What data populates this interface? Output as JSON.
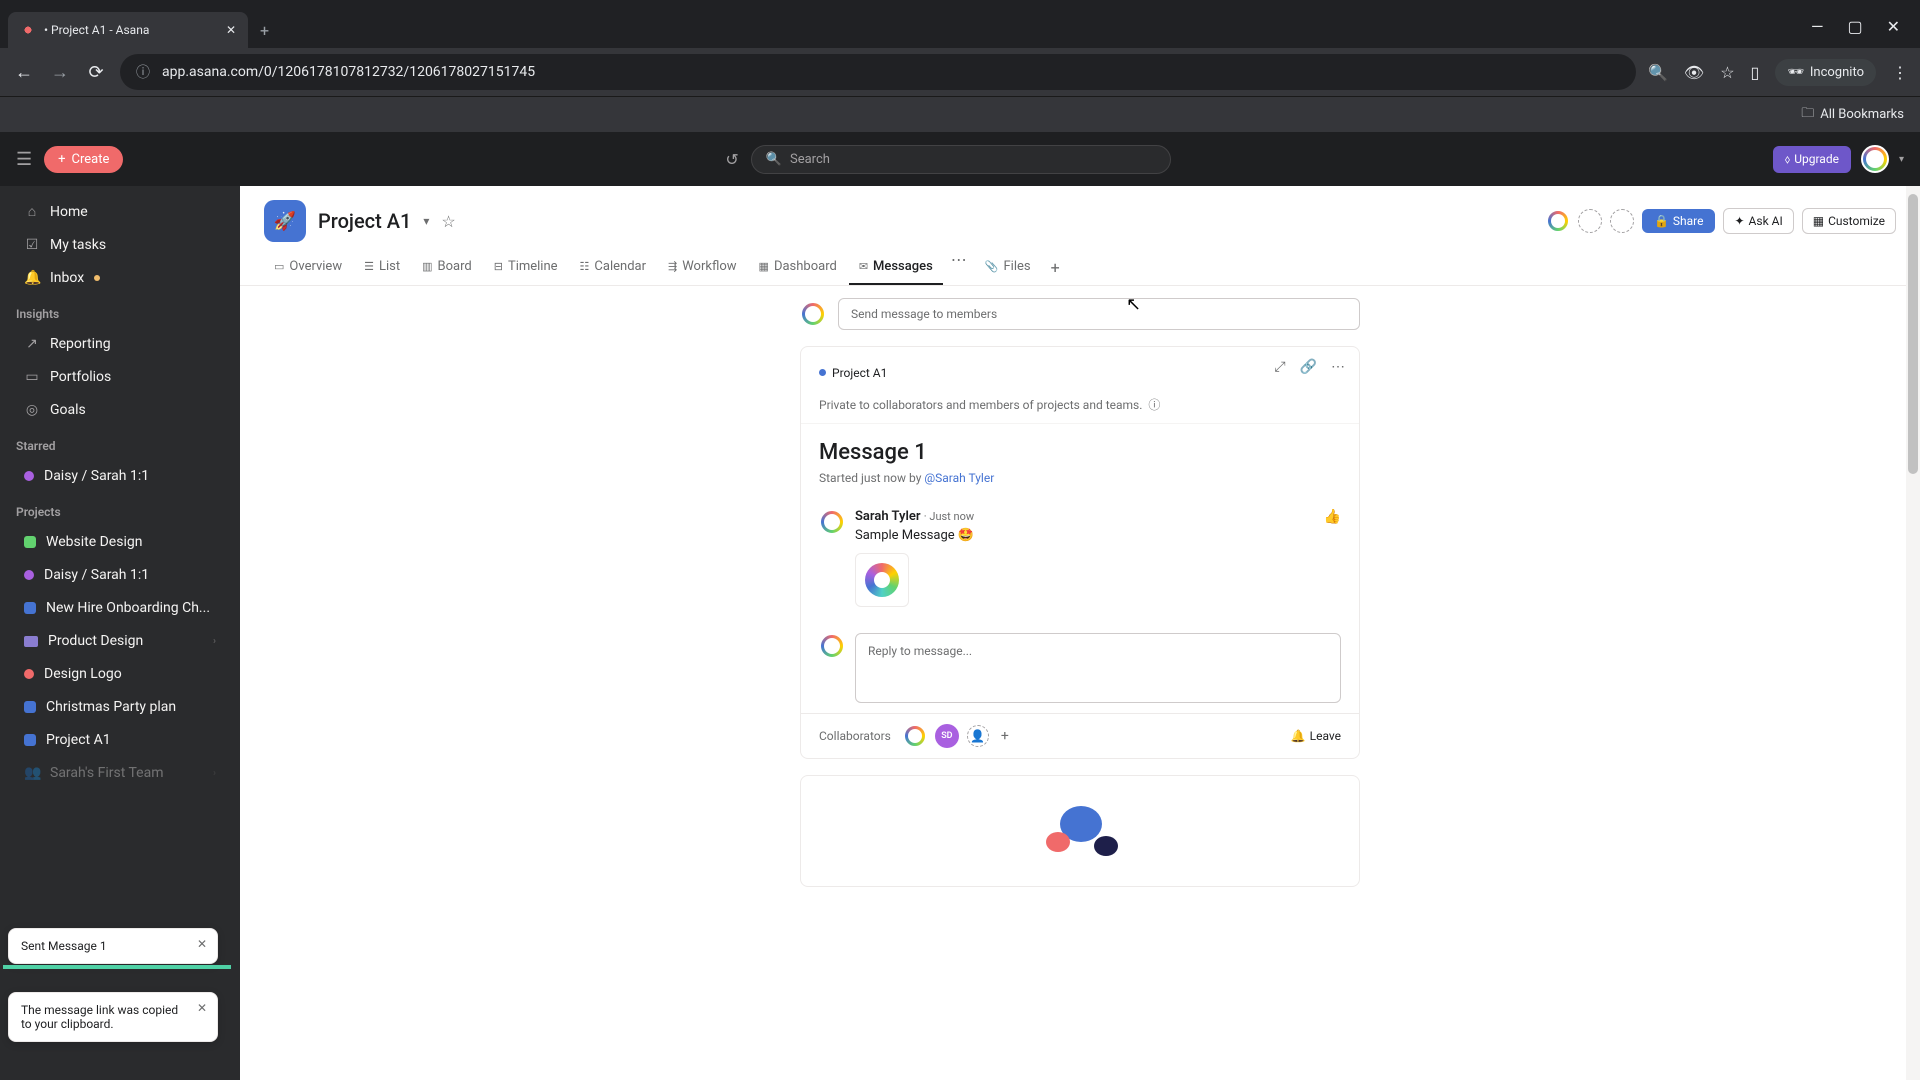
{
  "browser": {
    "tab_title": "• Project A1 - Asana",
    "url": "app.asana.com/0/1206178107812732/1206178027151745",
    "incognito_label": "Incognito",
    "bookmarks_label": "All Bookmarks"
  },
  "header": {
    "create_label": "Create",
    "search_placeholder": "Search",
    "upgrade_label": "Upgrade"
  },
  "sidebar": {
    "nav": [
      {
        "icon": "⌂",
        "label": "Home"
      },
      {
        "icon": "☑",
        "label": "My tasks"
      },
      {
        "icon": "🔔",
        "label": "Inbox",
        "badge": true
      }
    ],
    "insights_heading": "Insights",
    "insights": [
      {
        "icon": "↗",
        "label": "Reporting"
      },
      {
        "icon": "▭",
        "label": "Portfolios"
      },
      {
        "icon": "◎",
        "label": "Goals"
      }
    ],
    "starred_heading": "Starred",
    "starred": [
      {
        "color": "#a960e0",
        "label": "Daisy / Sarah 1:1"
      }
    ],
    "projects_heading": "Projects",
    "projects": [
      {
        "color": "#62d26f",
        "label": "Website Design",
        "type": "square"
      },
      {
        "color": "#a960e0",
        "label": "Daisy / Sarah 1:1",
        "type": "circle"
      },
      {
        "color": "#4573d2",
        "label": "New Hire Onboarding Ch...",
        "type": "square"
      },
      {
        "color": "#8a7dd0",
        "label": "Product Design",
        "type": "folder",
        "expandable": true
      },
      {
        "color": "#f06a6a",
        "label": "Design Logo",
        "type": "circle"
      },
      {
        "color": "#4573d2",
        "label": "Christmas Party plan",
        "type": "square"
      },
      {
        "color": "#4573d2",
        "label": "Project A1",
        "type": "square"
      }
    ],
    "team_label": "Sarah's First Team"
  },
  "project": {
    "title": "Project A1",
    "share_label": "Share",
    "ask_ai_label": "Ask AI",
    "customize_label": "Customize",
    "tabs": [
      {
        "icon": "▭",
        "label": "Overview"
      },
      {
        "icon": "☰",
        "label": "List"
      },
      {
        "icon": "▥",
        "label": "Board"
      },
      {
        "icon": "⊟",
        "label": "Timeline"
      },
      {
        "icon": "☷",
        "label": "Calendar"
      },
      {
        "icon": "⇶",
        "label": "Workflow"
      },
      {
        "icon": "▦",
        "label": "Dashboard"
      },
      {
        "icon": "✉",
        "label": "Messages",
        "active": true
      },
      {
        "icon": "📎",
        "label": "Files"
      }
    ]
  },
  "compose": {
    "placeholder": "Send message to members"
  },
  "message": {
    "project_chip": "Project A1",
    "privacy_text": "Private to collaborators and members of projects and teams.",
    "title": "Message 1",
    "meta_prefix": "Started just now by ",
    "meta_author": "@Sarah Tyler",
    "author_name": "Sarah Tyler",
    "post_time": "Just now",
    "body_text": "Sample Message 🤩",
    "reply_placeholder": "Reply to message...",
    "collaborators_label": "Collaborators",
    "collab_initials": "SD",
    "leave_label": "Leave"
  },
  "toasts": {
    "sent": "Sent Message 1",
    "copied": "The message link was copied to your clipboard."
  }
}
